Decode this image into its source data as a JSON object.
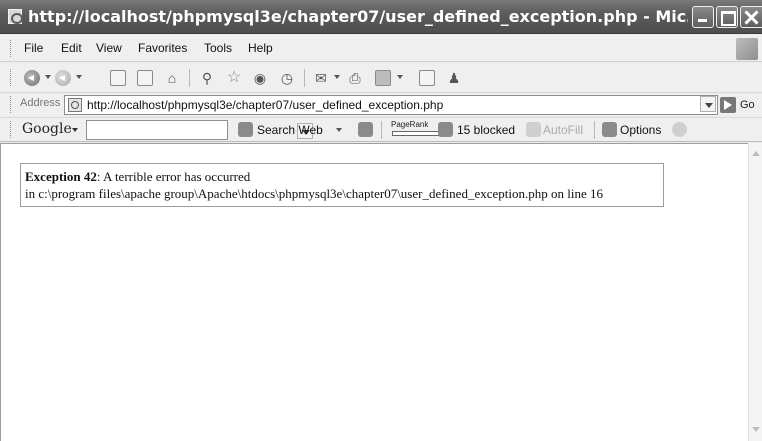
{
  "window": {
    "title": "http://localhost/phpmysql3e/chapter07/user_defined_exception.php - Mic…"
  },
  "menu": {
    "items": [
      "File",
      "Edit",
      "View",
      "Favorites",
      "Tools",
      "Help"
    ]
  },
  "address": {
    "label": "Address",
    "url": "http://localhost/phpmysql3e/chapter07/user_defined_exception.php",
    "go_label": "Go"
  },
  "google": {
    "logo": "Google",
    "search_value": "",
    "search_web_label": "Search Web",
    "pagerank_label": "PageRank",
    "blocked_label": "15 blocked",
    "autofill_label": "AutoFill",
    "options_label": "Options"
  },
  "page": {
    "exception_title": "Exception 42",
    "exception_message": ": A terrible error has occurred",
    "exception_location": "in c:\\program files\\apache group\\Apache\\htdocs\\phpmysql3e\\chapter07\\user_defined_exception.php on line 16"
  },
  "icons": {
    "toolbar": [
      "back-icon",
      "forward-icon",
      "stop-icon",
      "refresh-icon",
      "home-icon",
      "search-icon",
      "favorites-icon",
      "media-icon",
      "history-icon",
      "mail-icon",
      "print-icon",
      "edit-icon",
      "discuss-icon",
      "messenger-icon"
    ]
  }
}
